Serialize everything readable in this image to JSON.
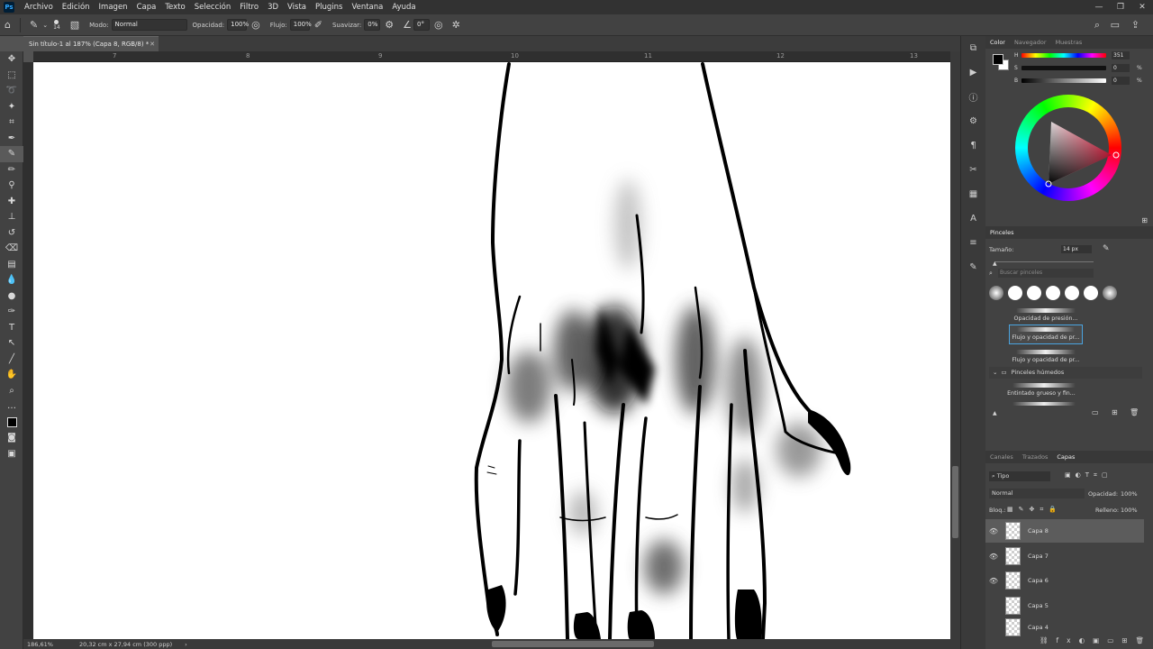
{
  "menubar": {
    "items": [
      "Archivo",
      "Edición",
      "Imagen",
      "Capa",
      "Texto",
      "Selección",
      "Filtro",
      "3D",
      "Vista",
      "Plugins",
      "Ventana",
      "Ayuda"
    ]
  },
  "options": {
    "brush_size": "14",
    "mode_label": "Modo:",
    "mode_value": "Normal",
    "opacity_label": "Opacidad:",
    "opacity_value": "100%",
    "flow_label": "Flujo:",
    "flow_value": "100%",
    "smooth_label": "Suavizar:",
    "smooth_value": "0%",
    "angle_value": "0°"
  },
  "document": {
    "tab_title": "Sin título-1 al 187% (Capa 8, RGB/8) *"
  },
  "ruler": {
    "ticks": [
      "7",
      "8",
      "9",
      "10",
      "11",
      "12",
      "13"
    ]
  },
  "status": {
    "zoom": "186,61%",
    "size": "20,32 cm x 27,94 cm (300 ppp)"
  },
  "color_panel": {
    "tabs": [
      "Color",
      "Navegador",
      "Muestras"
    ],
    "h_label": "H",
    "h_value": "351",
    "s_label": "S",
    "s_value": "0",
    "b_label": "B",
    "b_value": "0",
    "unit": "%"
  },
  "brushes_panel": {
    "title": "Pinceles",
    "size_label": "Tamaño:",
    "size_value": "14 px",
    "search_placeholder": "Buscar pinceles",
    "items": [
      "Opacidad de presión...",
      "Flujo y opacidad de pr...",
      "Flujo y opacidad de pr..."
    ],
    "group": "Pinceles húmedos",
    "group_item": "Entintado grueso y fin..."
  },
  "layers_panel": {
    "tabs": [
      "Canales",
      "Trazados",
      "Capas"
    ],
    "filter": "Tipo",
    "blend": "Normal",
    "opacity_label": "Opacidad:",
    "opacity_value": "100%",
    "lock_label": "Bloq.:",
    "fill_label": "Relleno:",
    "fill_value": "100%",
    "layers": [
      "Capa 8",
      "Capa 7",
      "Capa 6",
      "Capa 5",
      "Capa 4"
    ]
  },
  "colors": {
    "accent": "#31a8ff",
    "selected_brush_border": "#4aa3df"
  }
}
